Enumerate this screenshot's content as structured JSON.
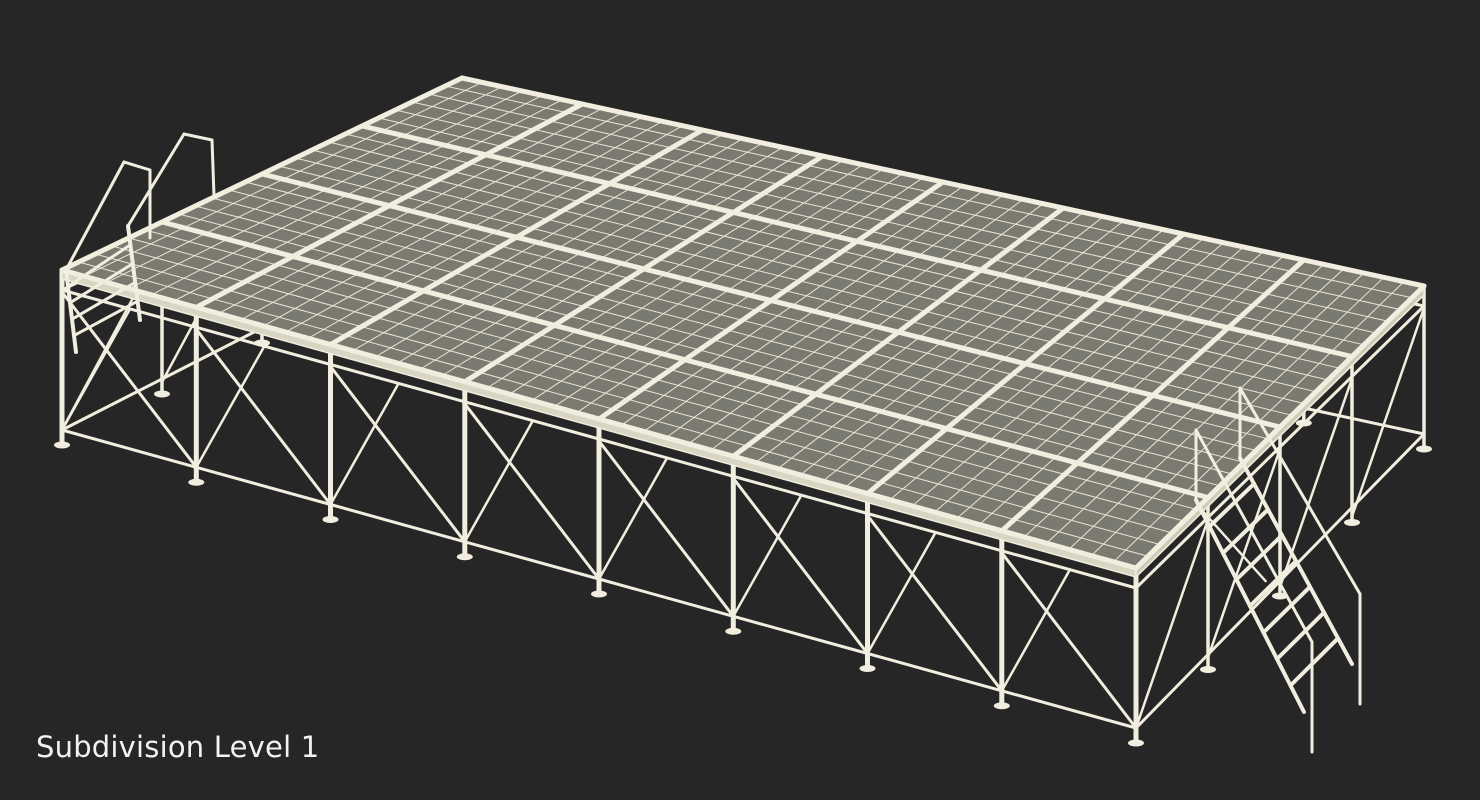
{
  "viewport": {
    "caption": "Subdivision Level 1"
  },
  "colors": {
    "background": "#262626",
    "frame": "#f1eedf",
    "deck": "#7a7a70",
    "deck_grid": "#e9e6d6",
    "caption_text": "#f2f2f2"
  },
  "model": {
    "panel_columns": 8,
    "panel_rows": 4,
    "tiles_per_panel": 6,
    "stairs": 2
  }
}
